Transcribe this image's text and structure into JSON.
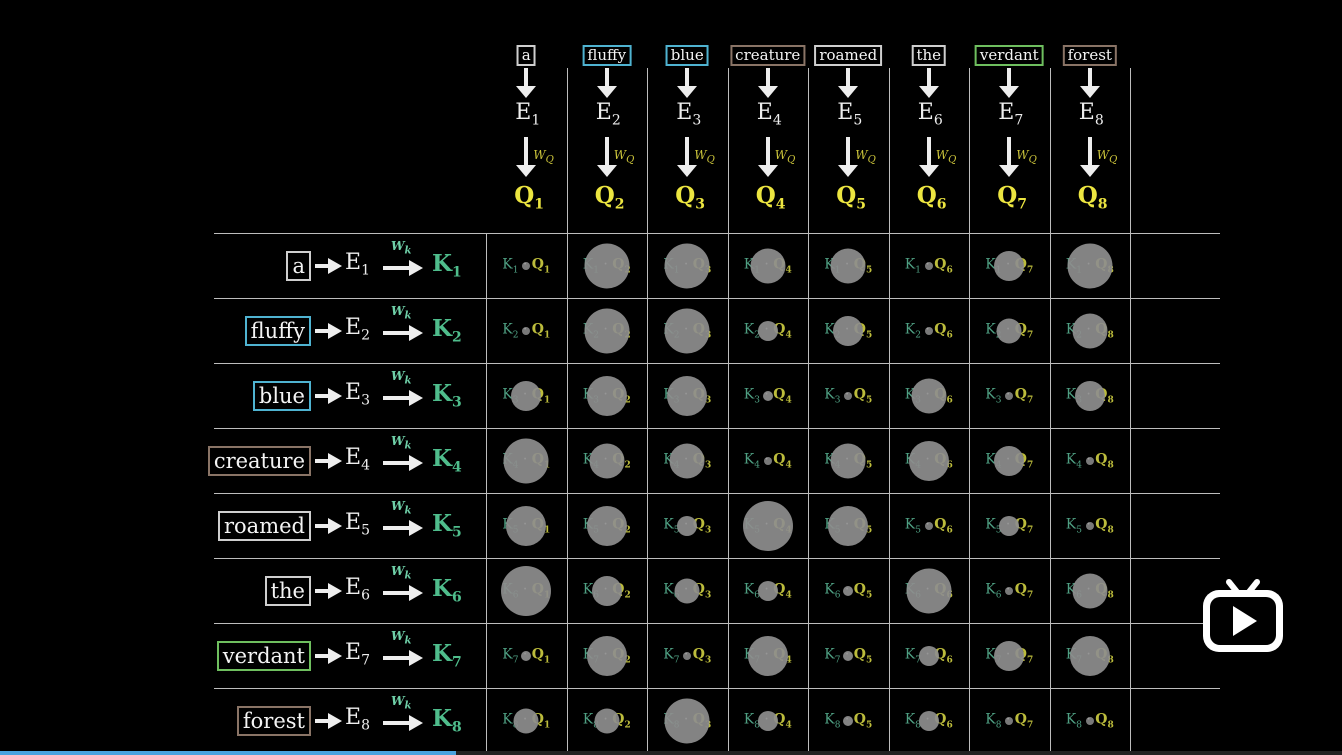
{
  "colors": {
    "query": "#ece540",
    "key": "#4fbd8c",
    "dot_circle": "#8e8e8e",
    "progress": "#4aa3df"
  },
  "tokens": [
    {
      "word": "a",
      "border": "#cfcfcf"
    },
    {
      "word": "fluffy",
      "border": "#4fb3d1"
    },
    {
      "word": "blue",
      "border": "#4fb3d1"
    },
    {
      "word": "creature",
      "border": "#8a7466"
    },
    {
      "word": "roamed",
      "border": "#cfcfcf"
    },
    {
      "word": "the",
      "border": "#cfcfcf"
    },
    {
      "word": "verdant",
      "border": "#6fbf5f"
    },
    {
      "word": "forest",
      "border": "#8a7466"
    }
  ],
  "labels": {
    "E": "E",
    "Q": "Q",
    "K": "K",
    "WQ": "W",
    "WQ_sub": "Q",
    "Wk": "W",
    "Wk_sub": "k"
  },
  "grid_scores": [
    [
      0.1,
      0.9,
      0.9,
      0.7,
      0.7,
      0.1,
      0.6,
      0.9
    ],
    [
      0.1,
      0.9,
      0.9,
      0.4,
      0.6,
      0.1,
      0.5,
      0.7
    ],
    [
      0.6,
      0.8,
      0.8,
      0.2,
      0.1,
      0.7,
      0.1,
      0.6
    ],
    [
      0.9,
      0.7,
      0.7,
      0.1,
      0.7,
      0.8,
      0.6,
      0.1
    ],
    [
      0.8,
      0.8,
      0.4,
      1.0,
      0.8,
      0.1,
      0.4,
      0.1
    ],
    [
      1.0,
      0.6,
      0.5,
      0.4,
      0.2,
      0.9,
      0.1,
      0.7
    ],
    [
      0.2,
      0.8,
      0.1,
      0.8,
      0.2,
      0.4,
      0.6,
      0.8
    ],
    [
      0.5,
      0.5,
      0.9,
      0.4,
      0.2,
      0.4,
      0.1,
      0.1
    ]
  ],
  "player": {
    "icon": "play-icon",
    "progress": 0.34
  }
}
